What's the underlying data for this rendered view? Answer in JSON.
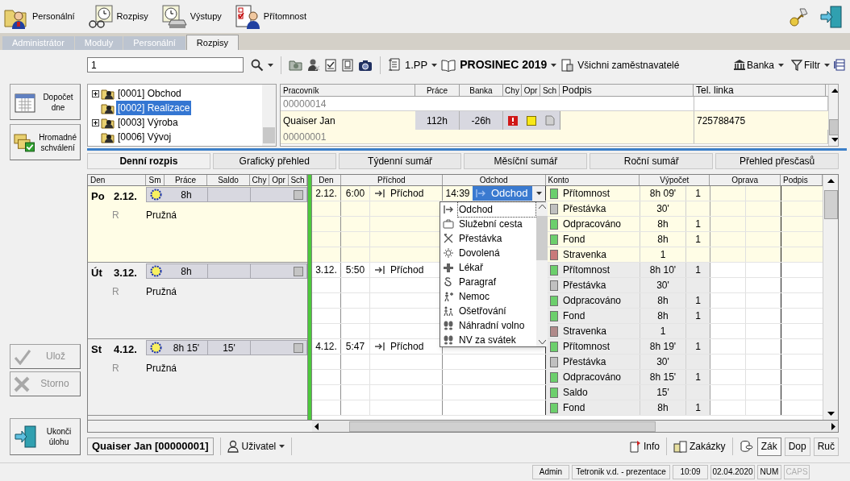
{
  "modules": [
    {
      "label": "Personální"
    },
    {
      "label": "Rozpisy"
    },
    {
      "label": "Výstupy"
    },
    {
      "label": "Přítomnost"
    }
  ],
  "tabs": [
    {
      "label": "Administrátor",
      "selected": false
    },
    {
      "label": "Moduly",
      "selected": false
    },
    {
      "label": "Personální",
      "selected": false
    },
    {
      "label": "Rozpisy",
      "selected": true
    }
  ],
  "filter_bar": {
    "search": {
      "value": "1"
    },
    "floor": "1.PP",
    "period": "PROSINEC 2019",
    "employers": "Všichni zaměstnavatelé",
    "bank": "Banka",
    "filter": "Filtr"
  },
  "side_buttons": [
    {
      "label": "Dopočet dne",
      "disabled": false
    },
    {
      "label": "Hromadné schválení",
      "disabled": false
    },
    {
      "label": "Ulož",
      "disabled": true
    },
    {
      "label": "Storno",
      "disabled": true
    },
    {
      "label": "Ukonči úlohu",
      "disabled": false
    }
  ],
  "tree": {
    "items": [
      {
        "label": "[0001] Obchod",
        "has_children": true,
        "selected": false
      },
      {
        "label": "[0002] Realizace",
        "has_children": false,
        "selected": true
      },
      {
        "label": "[0003] Výroba",
        "has_children": true,
        "selected": false
      },
      {
        "label": "[0006] Vývoj",
        "has_children": false,
        "selected": false
      }
    ]
  },
  "employees": {
    "columns": [
      "Pracovník",
      "Práce",
      "Banka",
      "Chy",
      "Opr",
      "Sch",
      "Podpis",
      "Tel. linka"
    ],
    "rows": [
      {
        "id": "00000014",
        "selected": false
      },
      {
        "name": "Quaiser Jan",
        "id": "00000001",
        "work": "112h",
        "bank": "-26h",
        "error": true,
        "correction": true,
        "signed": false,
        "phone": "725788475",
        "selected": true
      }
    ]
  },
  "view_tabs": [
    {
      "label": "Denní rozpis",
      "selected": true
    },
    {
      "label": "Grafický přehled",
      "selected": false
    },
    {
      "label": "Týdenní sumář",
      "selected": false
    },
    {
      "label": "Měsíční sumář",
      "selected": false
    },
    {
      "label": "Roční sumář",
      "selected": false
    },
    {
      "label": "Přehled přesčasů",
      "selected": false
    }
  ],
  "grid": {
    "columns_left": [
      "Den",
      "Sm",
      "Práce",
      "Saldo",
      "Chy",
      "Opr",
      "Sch"
    ],
    "columns_right": [
      "Den",
      "Příchod",
      "Odchod",
      "Konto",
      "Výpočet",
      "Oprava",
      "Podpis"
    ],
    "days": [
      {
        "weekday": "Po",
        "date": "2.12.",
        "shift_code": "R",
        "shift": "Pružná",
        "work": "8h",
        "approved": false,
        "selected": true,
        "arrival": {
          "date": "2.12.",
          "time": "6:00",
          "label": "Příchod"
        },
        "departure": {
          "time": "14:39",
          "label": "Odchod",
          "editing": true
        },
        "accounts": [
          {
            "name": "Přítomnost",
            "value": "8h 09'",
            "count": "1",
            "color": "#6ccf6c"
          },
          {
            "name": "Přestávka",
            "value": "30'",
            "color": "#c0c0c0"
          },
          {
            "name": "Odpracováno",
            "value": "8h",
            "count": "1",
            "color": "#6ccf6c"
          },
          {
            "name": "Fond",
            "value": "8h",
            "count": "1",
            "color": "#6ccf6c"
          },
          {
            "name": "Stravenka",
            "value": "1",
            "color": "#c97a7a"
          }
        ]
      },
      {
        "weekday": "Út",
        "date": "3.12.",
        "shift_code": "R",
        "shift": "Pružná",
        "work": "8h",
        "approved": false,
        "selected": false,
        "arrival": {
          "date": "3.12.",
          "time": "5:50",
          "label": "Příchod"
        },
        "accounts": [
          {
            "name": "Přítomnost",
            "value": "8h 10'",
            "count": "1",
            "color": "#6ccf6c"
          },
          {
            "name": "Přestávka",
            "value": "30'",
            "color": "#c0c0c0"
          },
          {
            "name": "Odpracováno",
            "value": "8h",
            "count": "1",
            "color": "#6ccf6c"
          },
          {
            "name": "Fond",
            "value": "8h",
            "count": "1",
            "color": "#6ccf6c"
          },
          {
            "name": "Stravenka",
            "value": "1",
            "color": "#b08a8a"
          }
        ]
      },
      {
        "weekday": "St",
        "date": "4.12.",
        "shift_code": "R",
        "shift": "Pružná",
        "work": "8h 15'",
        "balance": "15'",
        "approved": false,
        "selected": false,
        "arrival": {
          "date": "4.12.",
          "time": "5:47",
          "label": "Příchod"
        },
        "accounts": [
          {
            "name": "Přítomnost",
            "value": "8h 19'",
            "count": "1",
            "color": "#6ccf6c"
          },
          {
            "name": "Přestávka",
            "value": "30'",
            "color": "#c0c0c0"
          },
          {
            "name": "Odpracováno",
            "value": "8h 15'",
            "count": "1",
            "color": "#6ccf6c"
          },
          {
            "name": "Saldo",
            "value": "15'",
            "color": "#6ccf6c"
          },
          {
            "name": "Fond",
            "value": "8h",
            "count": "1",
            "color": "#6ccf6c"
          }
        ]
      }
    ]
  },
  "dropdown": {
    "items": [
      {
        "label": "Odchod",
        "selected": true
      },
      {
        "label": "Služební cesta",
        "selected": false
      },
      {
        "label": "Přestávka",
        "selected": false
      },
      {
        "label": "Dovolená",
        "selected": false
      },
      {
        "label": "Lékař",
        "selected": false
      },
      {
        "label": "Paragraf",
        "selected": false
      },
      {
        "label": "Nemoc",
        "selected": false
      },
      {
        "label": "Ošetřování",
        "selected": false
      },
      {
        "label": "Náhradní volno",
        "selected": false
      },
      {
        "label": "NV za svátek",
        "selected": false
      }
    ]
  },
  "employee_bar": {
    "name": "Quaiser Jan [00000001]",
    "user_menu": "Uživatel",
    "info": "Info",
    "orders": "Zakázky",
    "modes": [
      {
        "label": "Zák",
        "selected": true
      },
      {
        "label": "Dop",
        "selected": false
      },
      {
        "label": "Ruč",
        "selected": false
      }
    ]
  },
  "status_bar": [
    {
      "text": "Admin",
      "disabled": false
    },
    {
      "text": "Tetronik v.d. - prezentace",
      "disabled": false
    },
    {
      "text": "10:09",
      "disabled": false
    },
    {
      "text": "02.04.2020",
      "disabled": false
    },
    {
      "text": "NUM",
      "disabled": false
    },
    {
      "text": "CAPS",
      "disabled": true
    }
  ]
}
